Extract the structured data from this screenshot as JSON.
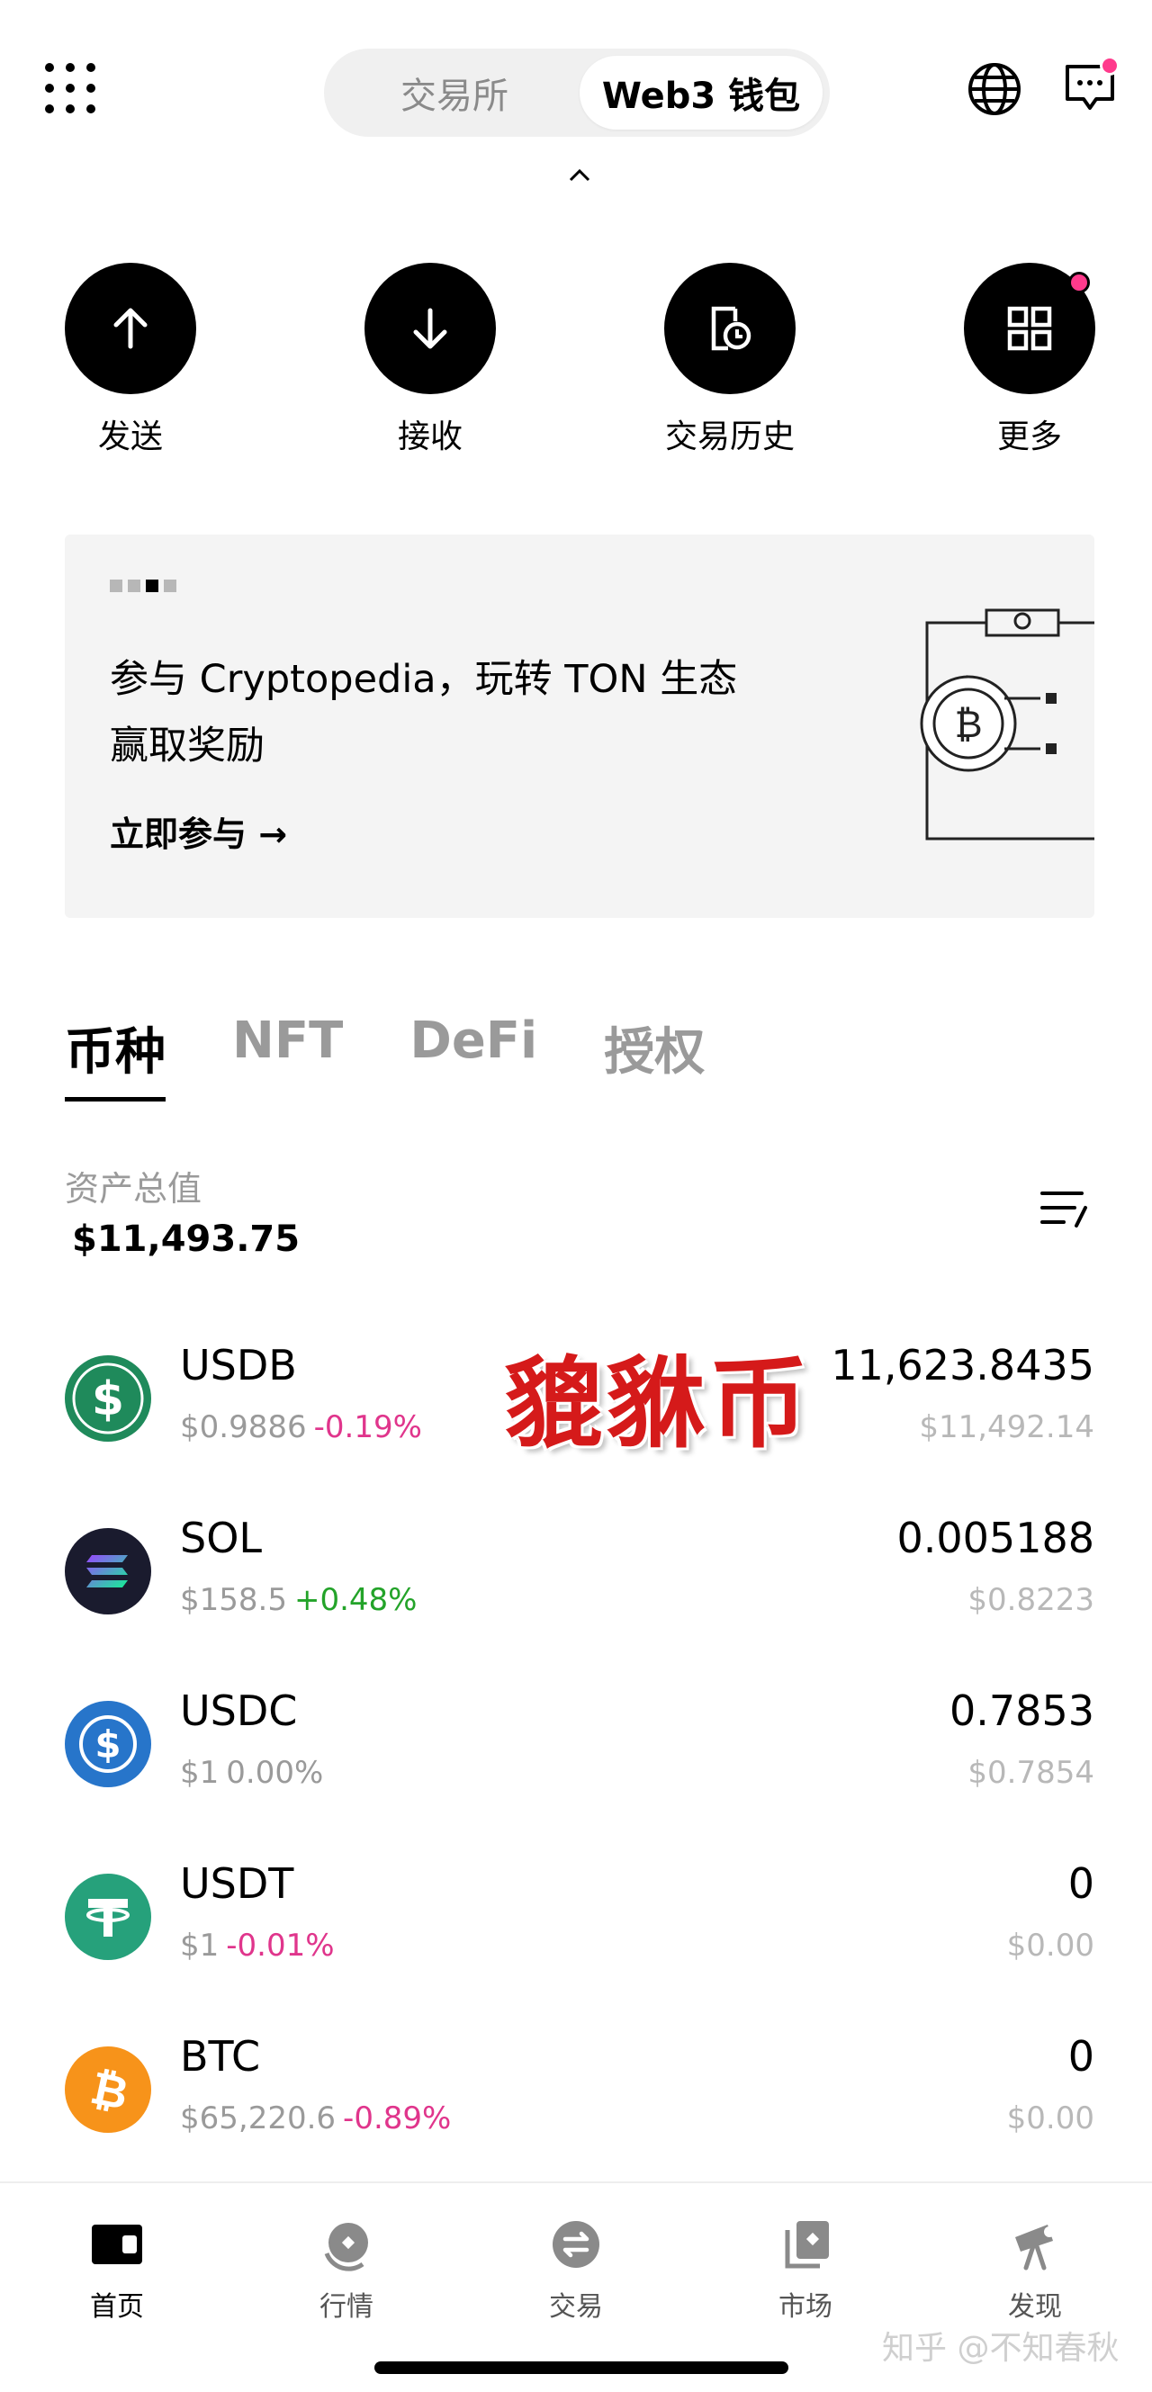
{
  "header": {
    "seg_left": "交易所",
    "seg_right": "Web3 钱包"
  },
  "actions": [
    {
      "label": "发送",
      "icon": "arrow-up-icon"
    },
    {
      "label": "接收",
      "icon": "arrow-down-icon"
    },
    {
      "label": "交易历史",
      "icon": "history-icon"
    },
    {
      "label": "更多",
      "icon": "more-apps-icon"
    }
  ],
  "banner": {
    "line1": "参与 Cryptopedia，玩转 TON 生态",
    "line2": "赢取奖励",
    "cta": "立即参与 →"
  },
  "tabs": [
    "币种",
    "NFT",
    "DeFi",
    "授权"
  ],
  "total": {
    "label": "资产总值",
    "value": "$11,493.75"
  },
  "overlay_text": "貔貅币",
  "tokens": [
    {
      "symbol": "USDB",
      "price": "$0.9886",
      "change": "-0.19%",
      "trend": "neg",
      "amount": "11,623.8435",
      "value": "$11,492.14",
      "color": "#1f8a5b"
    },
    {
      "symbol": "SOL",
      "price": "$158.5",
      "change": "+0.48%",
      "trend": "pos",
      "amount": "0.005188",
      "value": "$0.8223",
      "color": "#1a1b2e"
    },
    {
      "symbol": "USDC",
      "price": "$1",
      "change": "0.00%",
      "trend": "flat",
      "amount": "0.7853",
      "value": "$0.7854",
      "color": "#2775ca"
    },
    {
      "symbol": "USDT",
      "price": "$1",
      "change": "-0.01%",
      "trend": "neg",
      "amount": "0",
      "value": "$0.00",
      "color": "#26a17b"
    },
    {
      "symbol": "BTC",
      "price": "$65,220.6",
      "change": "-0.89%",
      "trend": "neg",
      "amount": "0",
      "value": "$0.00",
      "color": "#f7931a"
    }
  ],
  "nav": [
    {
      "label": "首页",
      "icon": "wallet-icon"
    },
    {
      "label": "行情",
      "icon": "market-icon"
    },
    {
      "label": "交易",
      "icon": "trade-icon"
    },
    {
      "label": "市场",
      "icon": "nft-market-icon"
    },
    {
      "label": "发现",
      "icon": "discover-icon"
    }
  ],
  "watermark": "知乎 @不知春秋"
}
